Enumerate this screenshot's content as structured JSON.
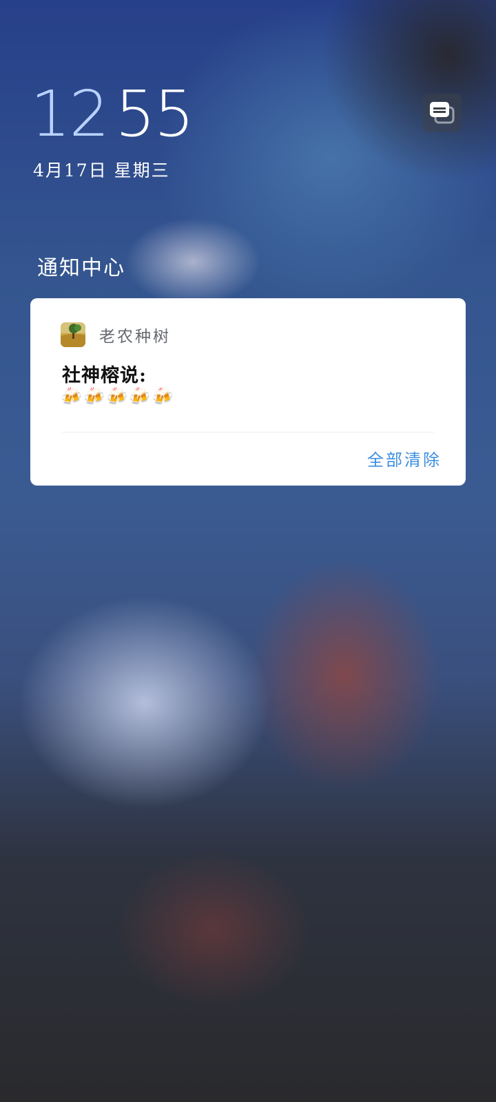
{
  "lockscreen": {
    "time_hour": "12",
    "time_minute": "55",
    "date": "4月17日 星期三"
  },
  "notification_center": {
    "title": "通知中心",
    "icon": "notification-history-icon"
  },
  "notification": {
    "app_icon": "farm-tree-app-icon",
    "app_name": "老农种树",
    "title": "社神榕说:",
    "body": "🍻🍻🍻🍻🍻"
  },
  "actions": {
    "clear_all": "全部清除"
  },
  "colors": {
    "hour": "#b9d2ff",
    "accent": "#3d8fe0",
    "card_bg": "#ffffff"
  }
}
